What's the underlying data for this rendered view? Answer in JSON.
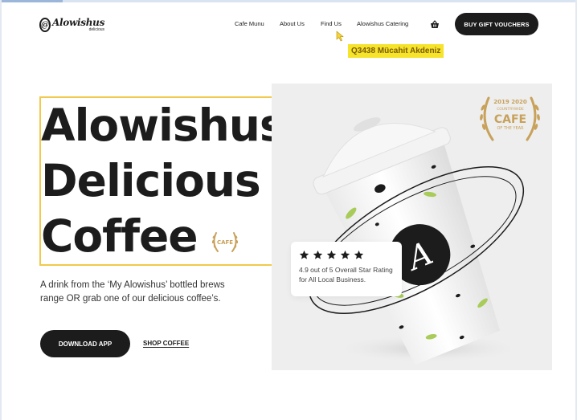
{
  "header": {
    "logo": {
      "name": "Alowishus",
      "sub": "delicious"
    },
    "nav": [
      {
        "label": "Cafe Munu"
      },
      {
        "label": "About Us"
      },
      {
        "label": "Find Us"
      },
      {
        "label": "Alowishus Catering"
      }
    ],
    "cart_icon": "basket-icon",
    "gift_button": "BUY GIFT VOUCHERS"
  },
  "tooltip": "Q3438 Mücahit Akdeniz",
  "hero": {
    "headline": [
      "Alowishus",
      "Delicious",
      "Coffee"
    ],
    "description": "A drink from the ‘My Alowishus’ bottled brews range OR grab one of our delicious coffee’s.",
    "download_button": "DOWNLOAD APP",
    "shop_link": "SHOP COFFEE"
  },
  "award": {
    "years": "2019 2020",
    "region": "COUNTRYWIDE",
    "title": "CAFE",
    "subtitle": "OF THE YEAR"
  },
  "mini_award": {
    "title": "CAFE"
  },
  "rating": {
    "stars": 5,
    "text": "4.9 out of 5 Overall Star Rating for All Local Business."
  },
  "colors": {
    "dark": "#1c1c1c",
    "gold": "#c8a15a",
    "leaf": "#a8cc5a",
    "tooltip": "#f6e32b",
    "selection": "#f2c94c"
  }
}
